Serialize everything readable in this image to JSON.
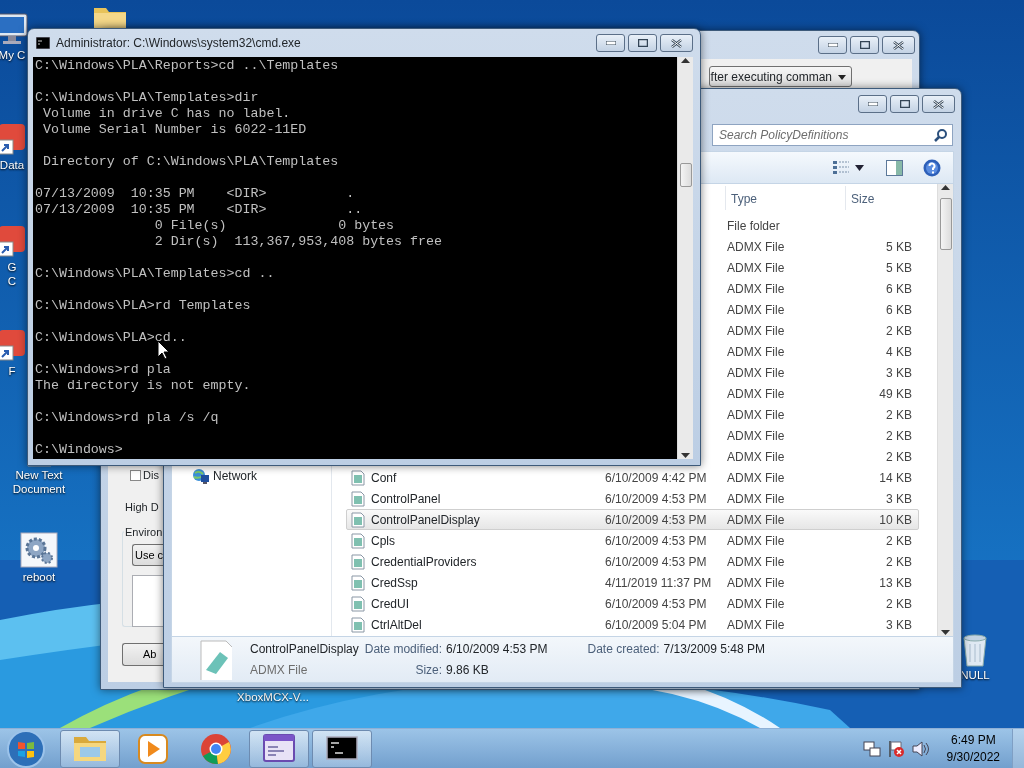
{
  "desktop_icons": [
    {
      "kind": "computer",
      "lines": [
        "My C"
      ]
    },
    {
      "kind": "folder"
    },
    {
      "kind": "shortcut",
      "lines": [
        "Data"
      ]
    },
    {
      "kind": "shortcut",
      "lines": [
        "G",
        "C"
      ]
    },
    {
      "kind": "shortcut",
      "lines": [
        "F"
      ]
    },
    {
      "kind": "textfile",
      "lines": [
        "New Text",
        "Document"
      ]
    },
    {
      "kind": "gear",
      "lines": [
        "reboot"
      ]
    },
    {
      "kind": "label-only",
      "lines": [
        "XboxMCX-V..."
      ]
    },
    {
      "kind": "recycle-bin",
      "lines": [
        "NULL"
      ]
    }
  ],
  "settings_window": {
    "dropdown": "fter executing comman",
    "checkbox": {
      "label": "Dis",
      "checked": false
    },
    "label": "High D",
    "group_label": "Environ",
    "button_1": "Use c",
    "button_2": "Ab"
  },
  "explorer": {
    "search": {
      "placeholder": "Search PolicyDefinitions"
    },
    "columns": [
      "Type",
      "Size"
    ],
    "nav_items": [
      {
        "label": "Network"
      }
    ],
    "rows": [
      {
        "type": "File folder",
        "selected": false
      },
      {
        "type": "ADMX File",
        "size": "5 KB",
        "selected": false
      },
      {
        "type": "ADMX File",
        "size": "5 KB",
        "selected": false
      },
      {
        "type": "ADMX File",
        "size": "6 KB",
        "selected": false
      },
      {
        "type": "ADMX File",
        "size": "6 KB",
        "selected": false
      },
      {
        "type": "ADMX File",
        "size": "2 KB",
        "selected": false
      },
      {
        "type": "ADMX File",
        "size": "4 KB",
        "selected": false
      },
      {
        "type": "ADMX File",
        "size": "3 KB",
        "selected": false
      },
      {
        "type": "ADMX File",
        "size": "49 KB",
        "selected": false
      },
      {
        "type": "ADMX File",
        "size": "2 KB",
        "selected": false
      },
      {
        "type": "ADMX File",
        "size": "2 KB",
        "selected": false
      },
      {
        "type": "ADMX File",
        "size": "2 KB",
        "selected": false
      },
      {
        "name": "Conf",
        "date": "6/10/2009 4:42 PM",
        "type": "ADMX File",
        "size": "14 KB",
        "selected": false
      },
      {
        "name": "ControlPanel",
        "date": "6/10/2009 4:53 PM",
        "type": "ADMX File",
        "size": "3 KB",
        "selected": false
      },
      {
        "name": "ControlPanelDisplay",
        "date": "6/10/2009 4:53 PM",
        "type": "ADMX File",
        "size": "10 KB",
        "selected": true
      },
      {
        "name": "Cpls",
        "date": "6/10/2009 4:53 PM",
        "type": "ADMX File",
        "size": "2 KB",
        "selected": false
      },
      {
        "name": "CredentialProviders",
        "date": "6/10/2009 4:53 PM",
        "type": "ADMX File",
        "size": "2 KB",
        "selected": false
      },
      {
        "name": "CredSsp",
        "date": "4/11/2019 11:37 PM",
        "type": "ADMX File",
        "size": "13 KB",
        "selected": false
      },
      {
        "name": "CredUI",
        "date": "6/10/2009 4:53 PM",
        "type": "ADMX File",
        "size": "2 KB",
        "selected": false
      },
      {
        "name": "CtrlAltDel",
        "date": "6/10/2009 5:04 PM",
        "type": "ADMX File",
        "size": "3 KB",
        "selected": false
      }
    ],
    "details": {
      "name": "ControlPanelDisplay",
      "type": "ADMX File",
      "fields": [
        {
          "label": "Date modified:",
          "value": "6/10/2009 4:53 PM"
        },
        {
          "label": "Size:",
          "value": "9.86 KB"
        },
        {
          "label": "Date created:",
          "value": "7/13/2009 5:48 PM"
        }
      ]
    }
  },
  "cmd": {
    "title": "Administrator: C:\\Windows\\system32\\cmd.exe",
    "blocks": [
      [
        "C:\\Windows\\PLA\\Reports>cd ..\\Templates"
      ],
      [
        "C:\\Windows\\PLA\\Templates>dir",
        " Volume in drive C has no label.",
        " Volume Serial Number is 6022-11ED"
      ],
      [
        " Directory of C:\\Windows\\PLA\\Templates"
      ],
      [
        "07/13/2009  10:35 PM    <DIR>          .",
        "07/13/2009  10:35 PM    <DIR>          ..",
        "               0 File(s)              0 bytes",
        "               2 Dir(s)  113,367,953,408 bytes free"
      ],
      [
        "C:\\Windows\\PLA\\Templates>cd .."
      ],
      [
        "C:\\Windows\\PLA>rd Templates"
      ],
      [
        "C:\\Windows\\PLA>cd.."
      ],
      [
        "C:\\Windows>rd pla",
        "The directory is not empty."
      ],
      [
        "C:\\Windows>rd pla /s /q"
      ],
      [
        "C:\\Windows>"
      ]
    ]
  },
  "taskbar": {
    "apps": [
      {
        "kind": "folder",
        "running": true
      },
      {
        "kind": "media",
        "running": false
      },
      {
        "kind": "browser",
        "running": false
      },
      {
        "kind": "window",
        "running": true
      },
      {
        "kind": "console",
        "running": true
      }
    ],
    "time": "6:49 PM",
    "date": "9/30/2022"
  }
}
